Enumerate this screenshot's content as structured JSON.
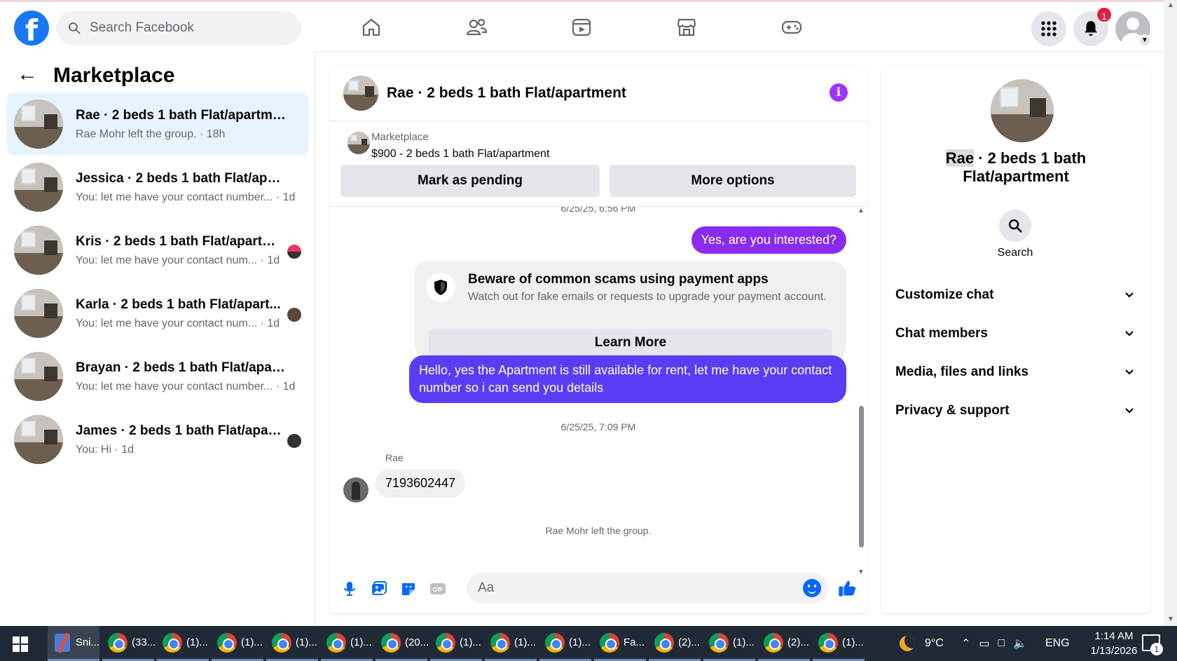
{
  "topbar": {
    "logo": "f",
    "search_placeholder": "Search Facebook",
    "nav_icons": [
      "home-icon",
      "friends-icon",
      "video-icon",
      "marketplace-icon",
      "gaming-icon"
    ],
    "notification_count": "1"
  },
  "left": {
    "title": "Marketplace",
    "conversations": [
      {
        "title": "Rae · 2 beds 1 bath Flat/apartment",
        "preview": "Rae Mohr left the group. · 18h",
        "active": true
      },
      {
        "title": "Jessica · 2 beds 1 bath Flat/apartm...",
        "preview": "You: let me have your contact number... · 1d"
      },
      {
        "title": "Kris · 2 beds 1 bath Flat/apartme...",
        "preview": "You: let me have your contact num... · 1d"
      },
      {
        "title": "Karla · 2 beds 1 bath Flat/apart...",
        "preview": "You: let me have your contact num... · 1d"
      },
      {
        "title": "Brayan · 2 beds 1 bath Flat/apartm...",
        "preview": "You: let me have your contact number... · 1d"
      },
      {
        "title": "James · 2 beds 1 bath Flat/apart...",
        "preview": "You: Hi · 1d"
      }
    ]
  },
  "chat": {
    "title": "Rae · 2 beds 1 bath Flat/apartment",
    "listing_source": "Marketplace",
    "listing_price": "$900 - 2 beds 1 bath Flat/apartment",
    "mark_pending": "Mark as pending",
    "more_options": "More options",
    "ts_cut": "6/25/25, 6:56 PM",
    "msg_interested": "Yes, are you interested?",
    "scam_title": "Beware of common scams using payment apps",
    "scam_desc": "Watch out for fake emails or requests to upgrade your payment account.",
    "learn_more": "Learn More",
    "msg_available": "Hello, yes the Apartment is still available for rent, let me have your contact number so i can send you details",
    "ts2": "6/25/25, 7:09 PM",
    "sender": "Rae",
    "msg_number": "7193602447",
    "system_msg": "Rae Mohr left the group.",
    "composer_placeholder": "Aa"
  },
  "right": {
    "title_name": "Rae",
    "title_rest": " · 2 beds 1 bath Flat/apartment",
    "search_label": "Search",
    "sections": [
      "Customize chat",
      "Chat members",
      "Media, files and links",
      "Privacy & support"
    ]
  },
  "taskbar": {
    "items": [
      "Sni...",
      "(33...",
      "(1)...",
      "(1)...",
      "(1)...",
      "(1)...",
      "(20...",
      "(1)...",
      "(1)...",
      "(1)...",
      "Fa...",
      "(2)...",
      "(1)...",
      "(2)...",
      "(1)..."
    ],
    "weather": "9°C",
    "language": "ENG",
    "time": "1:14 AM",
    "date": "1/13/2026",
    "notif_count": "1"
  },
  "colors": {
    "brand": "#1877f2",
    "accent_purple": "#8a2bf2",
    "accent_blue": "#5b3cf5",
    "badge": "#e41e3f"
  }
}
